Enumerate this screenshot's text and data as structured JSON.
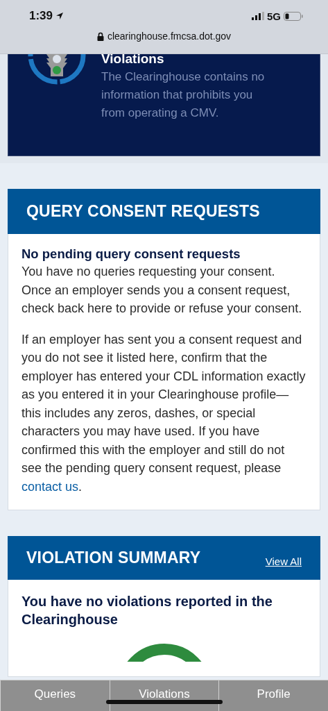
{
  "status_bar": {
    "time": "1:39",
    "network": "5G"
  },
  "address_bar": {
    "url": "clearinghouse.fmcsa.dot.gov"
  },
  "status_card": {
    "title": "Violations",
    "text": "The Clearinghouse contains no information that prohibits you from operating a CMV."
  },
  "consent_section": {
    "title": "QUERY CONSENT REQUESTS",
    "heading": "No pending query consent requests",
    "paragraphs": [
      {
        "text": "You have no queries requesting your consent. Once an employer sends you a consent request, check back here to provide or refuse your consent."
      },
      {
        "text": "If an employer has sent you a consent request and you do not see it listed here, confirm that the employer has entered your CDL information exactly as you entered it in your Clearinghouse profile—this includes any zeros, dashes, or special characters you may have used. If you have confirmed this with the employer and still do not see the pending query consent request, please ",
        "link": "contact us",
        "after": "."
      }
    ]
  },
  "violation_section": {
    "title": "VIOLATION SUMMARY",
    "link": "View All",
    "heading": "You have no violations reported in the Clearinghouse"
  },
  "tabs": [
    {
      "label": "Queries"
    },
    {
      "label": "Violations"
    },
    {
      "label": "Profile"
    }
  ]
}
